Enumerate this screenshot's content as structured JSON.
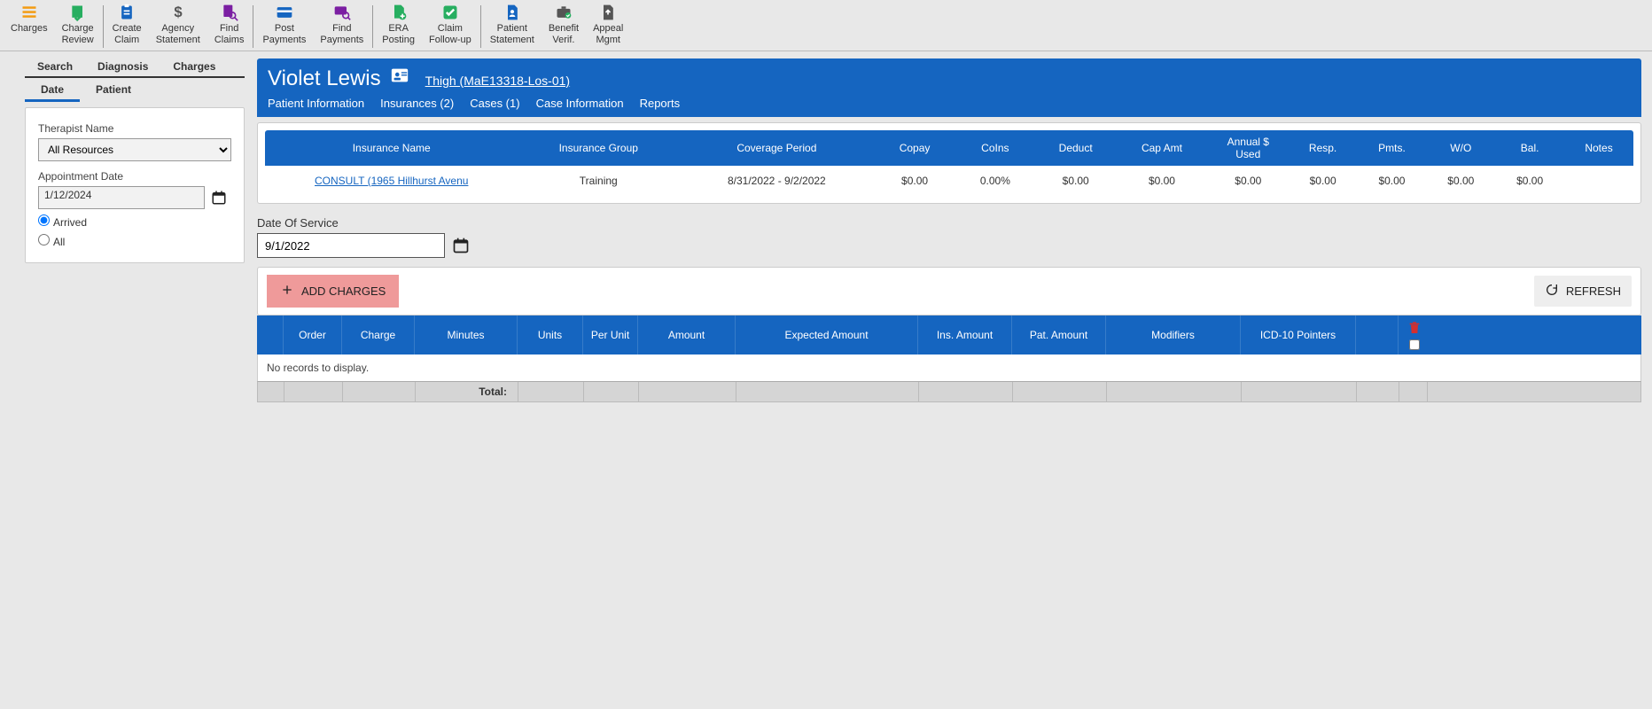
{
  "toolbar": {
    "items": [
      {
        "label": "Charges",
        "color": "#f39c12",
        "icon": "list"
      },
      {
        "label": "Charge\nReview",
        "color": "#27ae60",
        "icon": "review"
      },
      {
        "label": "Create\nClaim",
        "color": "#1565c0",
        "icon": "clipboard"
      },
      {
        "label": "Agency\nStatement",
        "color": "#555",
        "icon": "dollar"
      },
      {
        "label": "Find\nClaims",
        "color": "#7b1fa2",
        "icon": "search-doc"
      },
      {
        "label": "Post\nPayments",
        "color": "#1565c0",
        "icon": "card"
      },
      {
        "label": "Find\nPayments",
        "color": "#7b1fa2",
        "icon": "search-card"
      },
      {
        "label": "ERA\nPosting",
        "color": "#27ae60",
        "icon": "file-plus"
      },
      {
        "label": "Claim\nFollow-up",
        "color": "#27ae60",
        "icon": "check"
      },
      {
        "label": "Patient\nStatement",
        "color": "#1565c0",
        "icon": "file-user"
      },
      {
        "label": "Benefit\nVerif.",
        "color": "#555",
        "icon": "briefcase"
      },
      {
        "label": "Appeal\nMgmt",
        "color": "#555",
        "icon": "file-arrow"
      }
    ],
    "separators_after": [
      1,
      4,
      6,
      8
    ]
  },
  "left": {
    "lvl1_tabs": [
      "Search",
      "Diagnosis",
      "Charges"
    ],
    "lvl2_tabs": [
      "Date",
      "Patient"
    ],
    "lvl2_active": 0,
    "therapist_label": "Therapist Name",
    "therapist_value": "All Resources",
    "appt_label": "Appointment Date",
    "appt_value": "1/12/2024",
    "radio_arrived": "Arrived",
    "radio_all": "All"
  },
  "patient": {
    "name": "Violet Lewis",
    "case_link": "  Thigh (MaE13318-Los-01)",
    "subnav": [
      "Patient Information",
      "Insurances (2)",
      "Cases (1)",
      "Case Information",
      "Reports"
    ]
  },
  "ins_table": {
    "headers": [
      "Insurance Name",
      "Insurance Group",
      "Coverage Period",
      "Copay",
      "CoIns",
      "Deduct",
      "Cap Amt",
      "Annual $ Used",
      "Resp.",
      "Pmts.",
      "W/O",
      "Bal.",
      "Notes"
    ],
    "row": {
      "name": "CONSULT (1965 Hillhurst Avenu",
      "group": "Training",
      "period": "8/31/2022 - 9/2/2022",
      "copay": "$0.00",
      "coins": "0.00%",
      "deduct": "$0.00",
      "cap": "$0.00",
      "annual": "$0.00",
      "resp": "$0.00",
      "pmts": "$0.00",
      "wo": "$0.00",
      "bal": "$0.00",
      "notes": ""
    }
  },
  "dos": {
    "label": "Date Of Service",
    "value": "9/1/2022"
  },
  "actions": {
    "add": "ADD CHARGES",
    "refresh": "REFRESH"
  },
  "grid": {
    "headers": [
      "",
      "Order",
      "Charge",
      "Minutes",
      "Units",
      "Per Unit",
      "Amount",
      "Expected Amount",
      "Ins. Amount",
      "Pat. Amount",
      "Modifiers",
      "ICD-10 Pointers",
      "",
      ""
    ],
    "empty": "No records to display.",
    "total_label": "Total:"
  }
}
